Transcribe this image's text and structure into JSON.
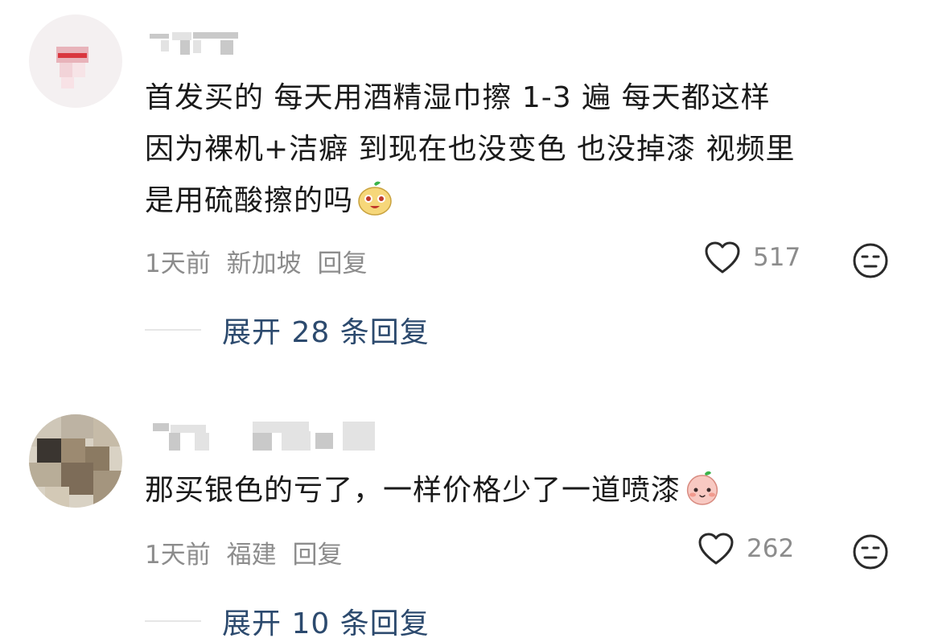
{
  "comments": [
    {
      "text_lines": [
        "首发买的 每天用酒精湿巾擦 1-3 遍 每天都这样",
        "因为裸机+洁癖 到现在也没变色 也没掉漆 视频里",
        "是用硫酸擦的吗"
      ],
      "emoji": "smiling-fruit-emoji",
      "time": "1天前",
      "location": "新加坡",
      "reply": "回复",
      "likes": "517",
      "expand_replies": "展开 28 条回复"
    },
    {
      "text_lines": [
        "那买银色的亏了，一样价格少了一道喷漆"
      ],
      "emoji": "shy-peach-emoji",
      "time": "1天前",
      "location": "福建",
      "reply": "回复",
      "likes": "262",
      "expand_replies": "展开 10 条回复"
    }
  ],
  "icons": {
    "like": "heart-icon",
    "dislike": "meh-face-icon"
  },
  "colors": {
    "link": "#2c4a6e",
    "meta": "#8c8c8c"
  }
}
